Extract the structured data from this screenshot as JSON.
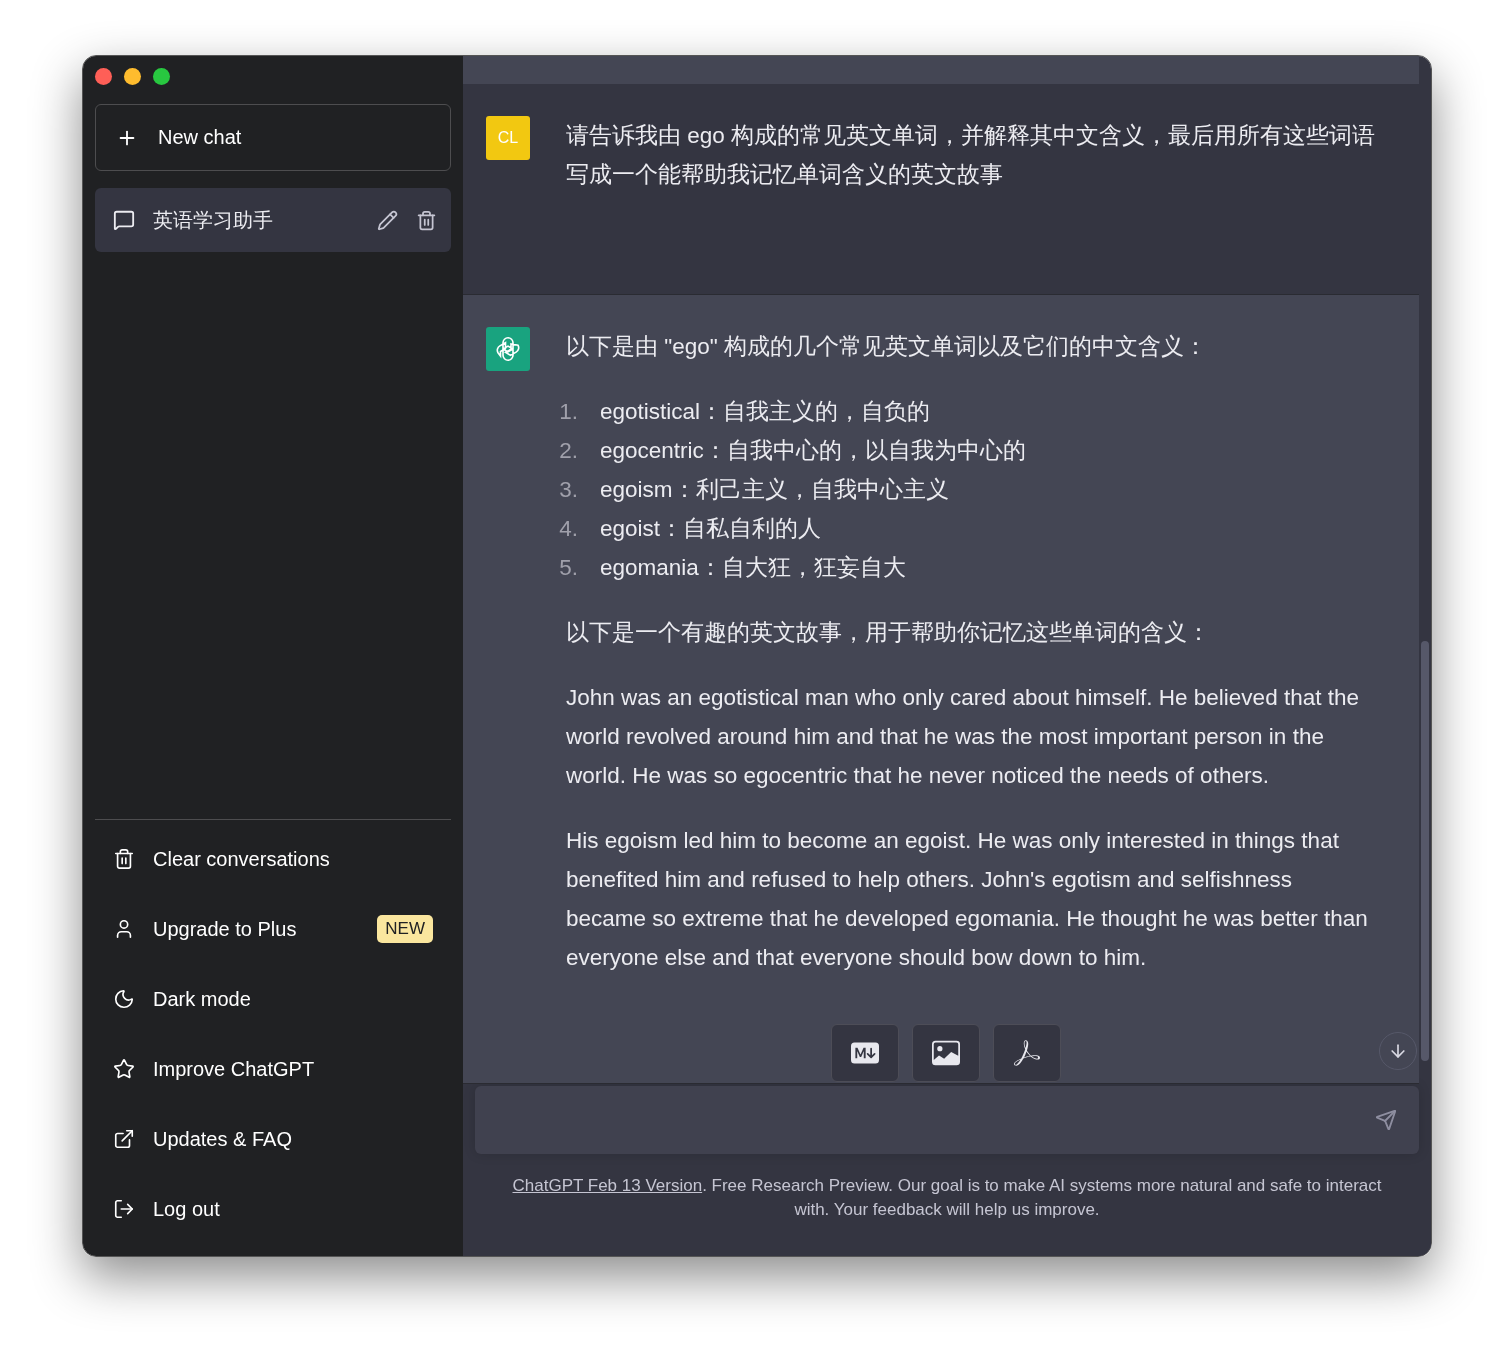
{
  "sidebar": {
    "new_chat": "New chat",
    "conversations": [
      {
        "title": "英语学习助手",
        "selected": true
      }
    ],
    "menu": [
      {
        "kind": "clear",
        "label": "Clear conversations"
      },
      {
        "kind": "upgrade",
        "label": "Upgrade to Plus",
        "badge": "NEW"
      },
      {
        "kind": "theme",
        "label": "Dark mode"
      },
      {
        "kind": "improve",
        "label": "Improve ChatGPT"
      },
      {
        "kind": "updates",
        "label": "Updates & FAQ"
      },
      {
        "kind": "logout",
        "label": "Log out"
      }
    ]
  },
  "messages": [
    {
      "kind": "user",
      "avatar": "CL",
      "blocks": [
        {
          "kind": "paragraph",
          "text": "请告诉我由 ego 构成的常见英文单词，并解释其中文含义，最后用所有这些词语写成一个能帮助我记忆单词含义的英文故事"
        }
      ]
    },
    {
      "kind": "assistant",
      "blocks": [
        {
          "kind": "paragraph",
          "text": "以下是由 \"ego\" 构成的几个常见英文单词以及它们的中文含义："
        },
        {
          "kind": "list",
          "items": [
            {
              "number": "1.",
              "text": "egotistical：自我主义的，自负的"
            },
            {
              "number": "2.",
              "text": "egocentric：自我中心的，以自我为中心的"
            },
            {
              "number": "3.",
              "text": "egoism：利己主义，自我中心主义"
            },
            {
              "number": "4.",
              "text": "egoist：自私自利的人"
            },
            {
              "number": "5.",
              "text": "egomania：自大狂，狂妄自大"
            }
          ]
        },
        {
          "kind": "paragraph",
          "text": "以下是一个有趣的英文故事，用于帮助你记忆这些单词的含义："
        },
        {
          "kind": "paragraph",
          "text": "John was an egotistical man who only cared about himself. He believed that the world revolved around him and that he was the most important person in the world. He was so egocentric that he never noticed the needs of others."
        },
        {
          "kind": "paragraph",
          "text": "His egoism led him to become an egoist. He was only interested in things that benefited him and refused to help others. John's egotism and selfishness became so extreme that he developed egomania. He thought he was better than everyone else and that everyone should bow down to him."
        }
      ]
    }
  ],
  "export_buttons": [
    {
      "kind": "markdown"
    },
    {
      "kind": "image"
    },
    {
      "kind": "pdf"
    }
  ],
  "footer": {
    "link": "ChatGPT Feb 13 Version",
    "text": ". Free Research Preview. Our goal is to make AI systems more natural and safe to interact with. Your feedback will help us improve."
  }
}
